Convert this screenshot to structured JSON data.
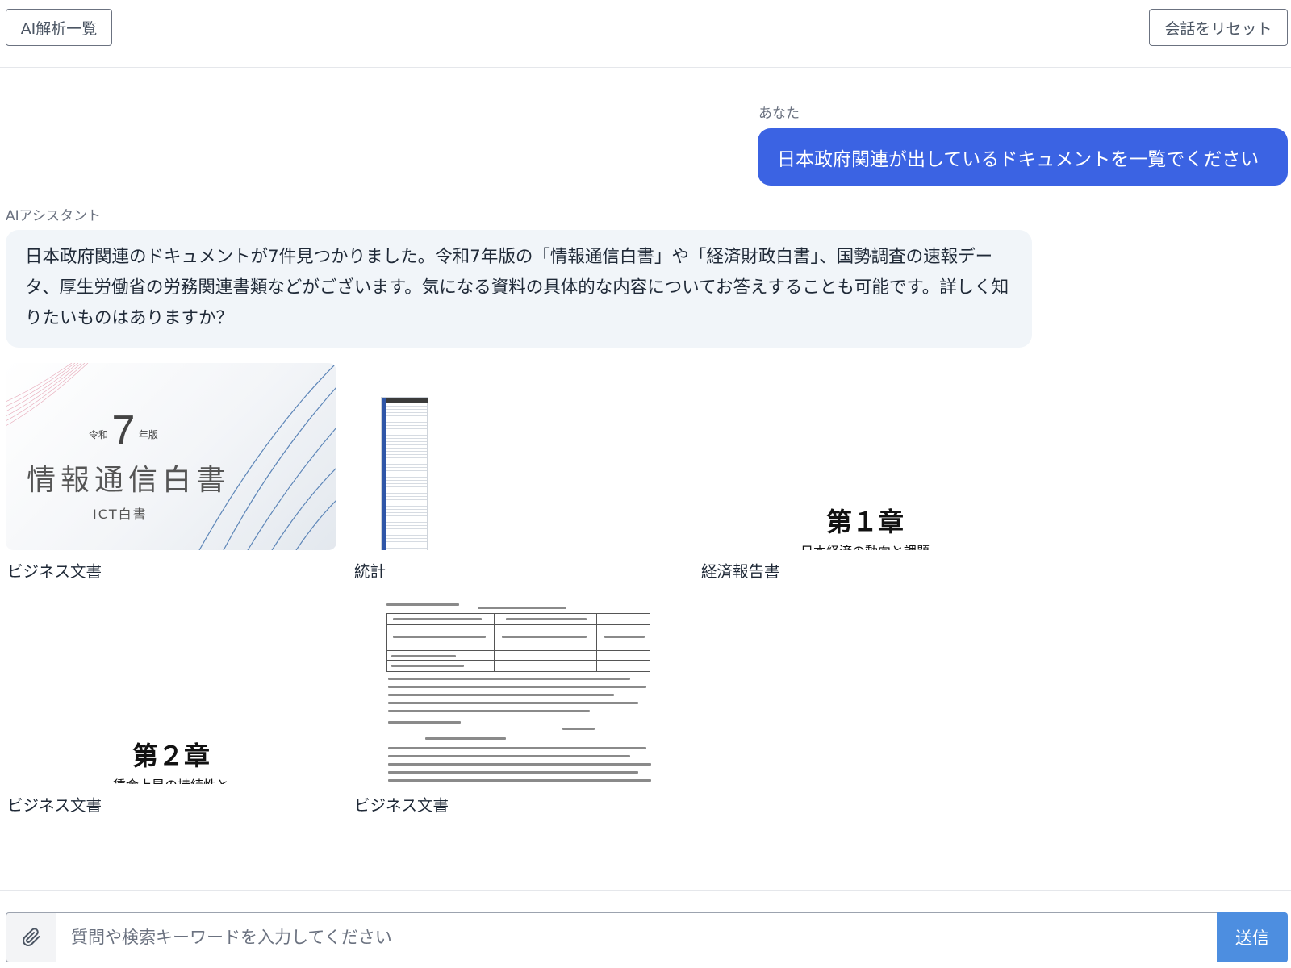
{
  "header": {
    "list_button": "AI解析一覧",
    "reset_button": "会話をリセット"
  },
  "conversation": {
    "user": {
      "sender": "あなた",
      "message": "日本政府関連が出しているドキュメントを一覧でください"
    },
    "assistant": {
      "sender": "AIアシスタント",
      "message": "日本政府関連のドキュメントが7件見つかりました。令和7年版の「情報通信白書」や「経済財政白書」、国勢調査の速報データ、厚生労働省の労務関連書類などがございます。気になる資料の具体的な内容についてお答えすることも可能です。詳しく知りたいものはありますか？"
    }
  },
  "documents": [
    {
      "label": "ビジネス文書",
      "thumb": {
        "era": "令和",
        "year": "7",
        "edition": "年版",
        "title": "情報通信白書",
        "subtitle": "ICT白書"
      }
    },
    {
      "label": "統計"
    },
    {
      "label": "経済報告書",
      "thumb": {
        "chapter": "第１章",
        "chapter_sub": "日本経済の動向と課題"
      }
    },
    {
      "label": "ビジネス文書",
      "thumb": {
        "chapter": "第２章",
        "chapter_sub": "賃金上昇の持続性と"
      }
    },
    {
      "label": "ビジネス文書"
    }
  ],
  "composer": {
    "placeholder": "質問や検索キーワードを入力してください",
    "value": "",
    "send_label": "送信",
    "attach_icon": "paperclip-icon"
  },
  "colors": {
    "user_bubble": "#3b63e3",
    "assistant_bubble": "#f1f5f9",
    "send_button": "#4d8ee0"
  }
}
